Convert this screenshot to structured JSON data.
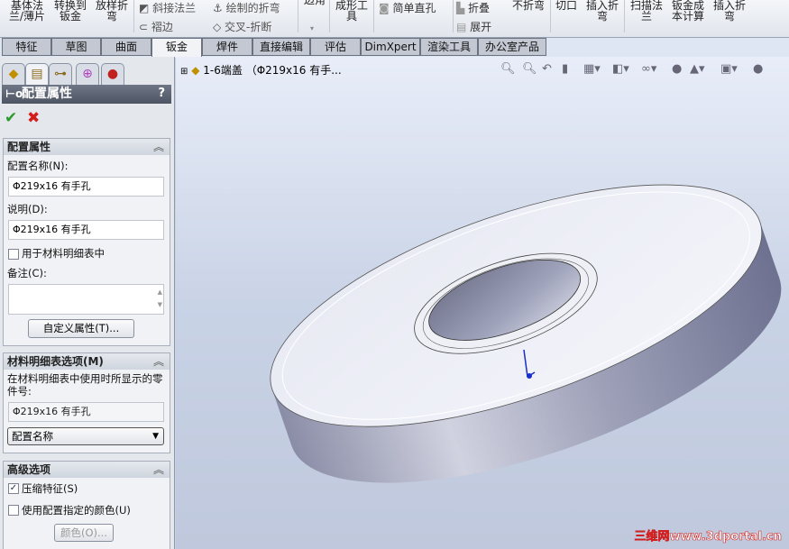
{
  "ribbon": {
    "buttons": [
      "基体法\n兰/薄片",
      "转换到\n钣金",
      "放样折\n弯"
    ],
    "small": [
      {
        "icon": "miter-flange-icon",
        "label": "斜接法兰"
      },
      {
        "icon": "hem-icon",
        "label": "褶边"
      },
      {
        "icon": "sketched-bend-icon",
        "label": "绘制的折弯"
      },
      {
        "icon": "cross-break-icon",
        "label": "交叉-折断"
      }
    ],
    "partial": "边角",
    "forming": "成形工\n具",
    "simple_hole": "简单直孔",
    "fold": "折叠",
    "unfold": "展开",
    "no_bends": "不折弯",
    "cut": "切口",
    "insert_bends": "插入折\n弯",
    "swept_flange": "扫描法\n兰",
    "cost": "钣金成\n本计算",
    "insert_bends2": "插入折\n弯"
  },
  "tabs": [
    {
      "label": "特征"
    },
    {
      "label": "草图"
    },
    {
      "label": "曲面"
    },
    {
      "label": "钣金",
      "active": true
    },
    {
      "label": "焊件"
    },
    {
      "label": "直接编辑"
    },
    {
      "label": "评估"
    },
    {
      "label": "DimXpert"
    },
    {
      "label": "渲染工具"
    },
    {
      "label": "办公室产品"
    }
  ],
  "panel": {
    "title": "配置属性",
    "help": "?",
    "config_group": {
      "title": "配置属性",
      "name_label": "配置名称(N):",
      "name_value": "Φ219x16 有手孔",
      "desc_label": "说明(D):",
      "desc_value": "Φ219x16 有手孔",
      "use_in_bom": "用于材料明细表中",
      "use_in_bom_checked": false,
      "comment_label": "备注(C):",
      "comment_value": "",
      "custom_props": "自定义属性(T)..."
    },
    "bom_group": {
      "title": "材料明细表选项(M)",
      "desc": "在材料明细表中使用时所显示的零件号:",
      "part_number": "Φ219x16 有手孔",
      "select_value": "配置名称"
    },
    "adv_group": {
      "title": "高级选项",
      "suppress": "压缩特征(S)",
      "suppress_checked": true,
      "use_color": "使用配置指定的颜色(U)",
      "use_color_checked": false,
      "color_button": "颜色(O)..."
    }
  },
  "view": {
    "tree_label": "1-6端盖 （Φ219x16 有手...",
    "watermark": "三维网www.3dportal.cn",
    "model_color": "#d6d9ea"
  }
}
